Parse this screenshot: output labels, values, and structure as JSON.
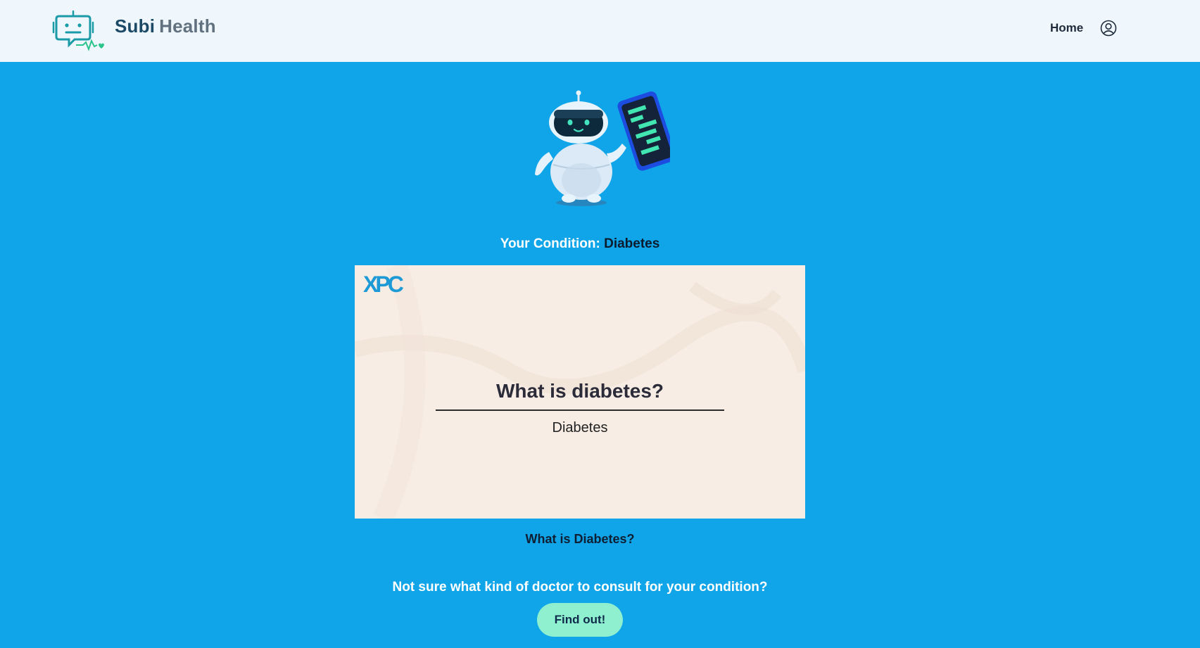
{
  "header": {
    "brand_primary": "Subi",
    "brand_secondary": "Health",
    "nav_home": "Home",
    "logo_icon": "robot-chat-heart-logo",
    "user_icon": "user-profile-icon"
  },
  "main": {
    "condition_label": "Your Condition:",
    "condition_value": "Diabetes",
    "video": {
      "channel_logo": "XPC",
      "title": "What is diabetes?",
      "subtitle": "Diabetes"
    },
    "video_caption": "What is Diabetes?",
    "doctor_prompt": "Not sure what kind of doctor to consult for your condition?",
    "find_button": "Find out!"
  },
  "colors": {
    "page_background": "#10a5e8",
    "navbar_background": "#eff7fd",
    "button_background": "#8ff0cf",
    "brand_dark": "#1c4a66",
    "brand_gray": "#61717f",
    "logo_teal": "#1b9aa8",
    "video_background": "#f8ede4"
  }
}
